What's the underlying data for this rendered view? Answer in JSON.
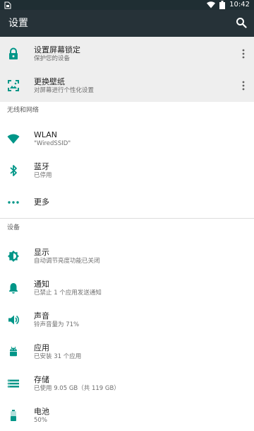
{
  "status_bar": {
    "left_icon": "sim-icon",
    "time": "10:42"
  },
  "app_bar": {
    "title": "设置"
  },
  "top_section": {
    "items": [
      {
        "title": "设置屏幕锁定",
        "subtitle": "保护您的设备"
      },
      {
        "title": "更换壁纸",
        "subtitle": "对屏幕进行个性化设置"
      }
    ]
  },
  "wireless": {
    "header": "无线和网络",
    "items": [
      {
        "title": "WLAN",
        "subtitle": "\"WiredSSID\""
      },
      {
        "title": "蓝牙",
        "subtitle": "已停用"
      },
      {
        "title": "更多"
      }
    ]
  },
  "device": {
    "header": "设备",
    "items": [
      {
        "title": "显示",
        "subtitle": "自动调节亮度功能已关闭"
      },
      {
        "title": "通知",
        "subtitle": "已禁止 1 个应用发送通知"
      },
      {
        "title": "声音",
        "subtitle": "铃声音量为 71%"
      },
      {
        "title": "应用",
        "subtitle": "已安装 31 个应用"
      },
      {
        "title": "存储",
        "subtitle": "已使用 9.05 GB（共 119 GB）"
      },
      {
        "title": "电池",
        "subtitle": "50%"
      }
    ]
  },
  "colors": {
    "teal": "#009688",
    "appbar": "#263238",
    "statusbar": "#1f2e33"
  },
  "icons": [
    "lock-icon",
    "wallpaper-icon",
    "wifi-icon",
    "bluetooth-icon",
    "more-horiz-icon",
    "brightness-icon",
    "notification-icon",
    "volume-icon",
    "android-icon",
    "storage-icon",
    "battery-icon",
    "search-icon",
    "overflow-icon"
  ]
}
